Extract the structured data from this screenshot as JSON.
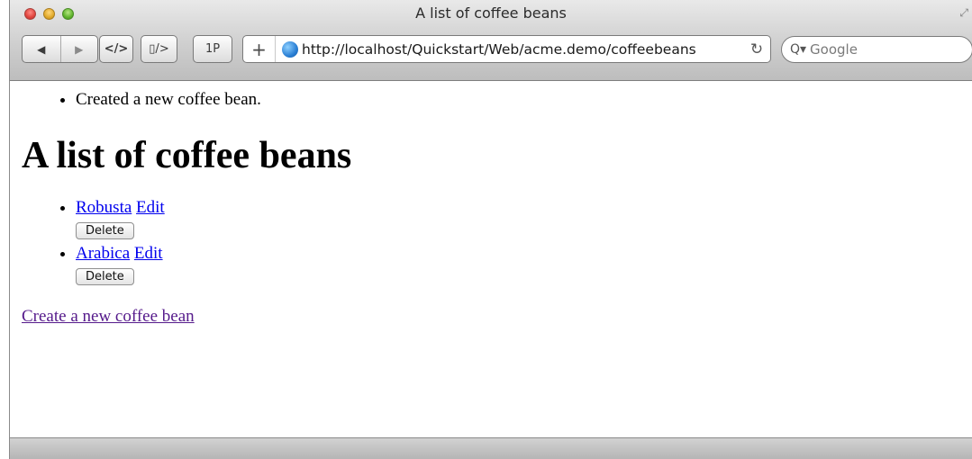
{
  "window": {
    "title": "A list of coffee beans"
  },
  "toolbar": {
    "back_icon": "◀",
    "forward_icon": "▶",
    "view_source_label": "</>",
    "view_source_alt_label": "▯/>",
    "onepassword_label": "1P",
    "add_label": "+",
    "url": "http://localhost/Quickstart/Web/acme.demo/coffeebeans",
    "reload_icon": "↻",
    "search_placeholder": "Google"
  },
  "page": {
    "flash_messages": [
      "Created a new coffee bean."
    ],
    "heading": "A list of coffee beans",
    "beans": [
      {
        "name": "Robusta",
        "edit_label": "Edit",
        "delete_label": "Delete"
      },
      {
        "name": "Arabica",
        "edit_label": "Edit",
        "delete_label": "Delete"
      }
    ],
    "create_link": "Create a new coffee bean"
  }
}
